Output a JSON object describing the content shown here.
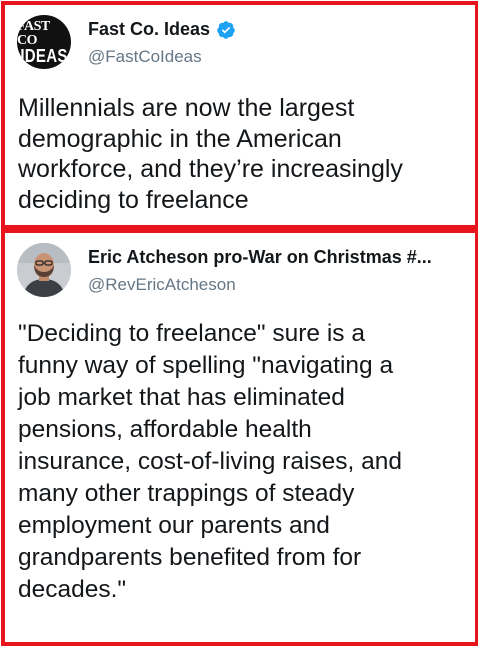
{
  "colors": {
    "highlight_border": "#e8141b",
    "verified_blue": "#1da1f2",
    "handle_gray": "#657786",
    "text": "#14171a"
  },
  "tweets": [
    {
      "avatar_icon": "fast-co-ideas-logo",
      "avatar_logo_line1": "FAST CO",
      "avatar_logo_line2": "IDEAS",
      "display_name": "Fast Co. Ideas",
      "verified": true,
      "handle": "@FastCoIdeas",
      "text": "Millennials are now the largest\ndemographic in the American\nworkforce, and they’re increasingly\ndeciding to freelance"
    },
    {
      "avatar_icon": "profile-photo",
      "display_name": "Eric Atcheson pro-War on Christmas #...",
      "verified": false,
      "handle": "@RevEricAtcheson",
      "text": "\"Deciding to freelance\" sure is a\nfunny way of spelling \"navigating a\njob market that has eliminated\npensions, affordable health\ninsurance, cost-of-living raises, and\nmany other trappings of steady\nemployment our parents and\ngrandparents benefited from for\ndecades.\""
    }
  ]
}
